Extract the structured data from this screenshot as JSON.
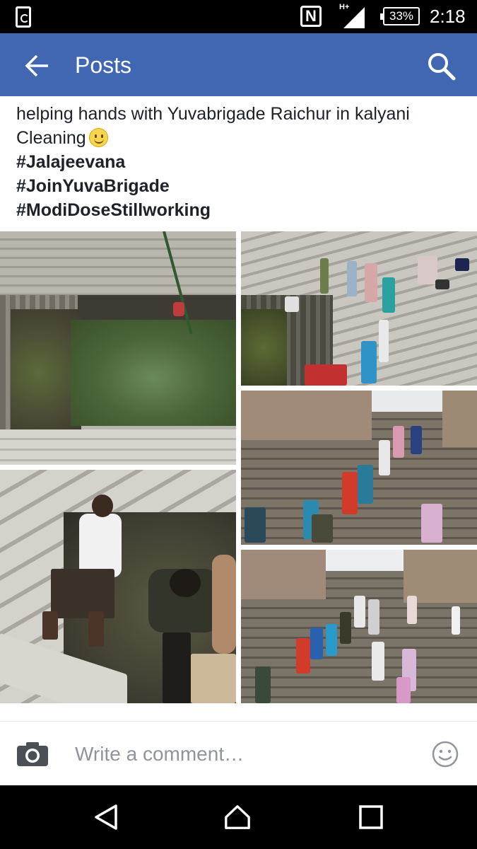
{
  "status_bar": {
    "network": "H+",
    "battery": "33%",
    "time": "2:18",
    "icons": [
      "sync-icon",
      "nfc-icon",
      "signal-icon",
      "battery-icon"
    ]
  },
  "app_bar": {
    "title": "Posts",
    "back_icon": "arrow-left-icon",
    "search_icon": "search-icon",
    "background": "#4267b2"
  },
  "post": {
    "lines": [
      "helping hands with Yuvabrigade Raichur in kalyani",
      "Cleaning"
    ],
    "emoji": "slightly-smiling-face",
    "hashtags": [
      "#Jalajeevana",
      "#JoinYuvaBrigade",
      "#ModiDoseStillworking"
    ],
    "photos": [
      {
        "subject": "step-well-pond"
      },
      {
        "subject": "volunteers-on-steps"
      },
      {
        "subject": "man-cleaning-debris"
      },
      {
        "subject": "volunteers-on-stairs-1"
      },
      {
        "subject": "volunteers-on-stairs-2"
      }
    ]
  },
  "comment_bar": {
    "placeholder": "Write a comment…",
    "camera_icon": "camera-icon",
    "emoji_icon": "smiley-icon"
  },
  "nav_bar": {
    "buttons": [
      "back-triangle-icon",
      "home-icon",
      "recents-square-icon"
    ]
  }
}
